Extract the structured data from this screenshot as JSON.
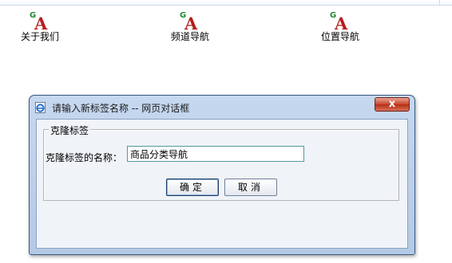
{
  "pages": [
    {
      "label": "关于我们",
      "icon": "ga-page-icon"
    },
    {
      "label": "频道导航",
      "icon": "ga-page-icon"
    },
    {
      "label": "位置导航",
      "icon": "ga-page-icon"
    }
  ],
  "dialog": {
    "title": "请输入新标签名称 -- 网页对话框",
    "close_label": "x",
    "fieldset_legend": "克隆标签",
    "name_label": "克隆标签的名称：",
    "name_value": "商品分类导航",
    "ok_label": "确定",
    "cancel_label": "取消"
  },
  "colors": {
    "icon_g": "#1e8a2e",
    "icon_a": "#b51e1e",
    "dialog_frame": "#b3c9e6",
    "close_button": "#c8452d"
  }
}
